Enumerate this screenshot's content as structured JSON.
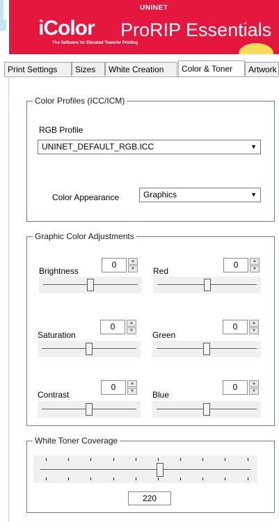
{
  "brand": {
    "top": "UNINET",
    "main": "iColor",
    "product": "ProRIP Essentials",
    "tagline": "The Software for Elevated Transfer Printing",
    "color": "#e5173f"
  },
  "tabs": [
    {
      "label": "Print Settings",
      "active": false
    },
    {
      "label": "Sizes",
      "active": false
    },
    {
      "label": "White Creation",
      "active": false
    },
    {
      "label": "Color & Toner",
      "active": true
    },
    {
      "label": "Artwork",
      "active": false
    }
  ],
  "color_profiles": {
    "title": "Color Profiles (ICC/ICM)",
    "rgb_label": "RGB Profile",
    "rgb_value": "UNINET_DEFAULT_RGB.ICC",
    "appearance_label": "Color Appearance",
    "appearance_value": "Graphics"
  },
  "adjustments": {
    "title": "Graphic Color Adjustments",
    "brightness": {
      "label": "Brightness",
      "value": "0",
      "level": 0
    },
    "red": {
      "label": "Red",
      "value": "0",
      "level": 0
    },
    "saturation": {
      "label": "Saturation",
      "value": "0",
      "level": 0
    },
    "green": {
      "label": "Green",
      "value": "0",
      "level": 0
    },
    "contrast": {
      "label": "Contrast",
      "value": "0",
      "level": 0
    },
    "blue": {
      "label": "Blue",
      "value": "0",
      "level": 0
    }
  },
  "white_toner": {
    "title": "White Toner Coverage",
    "value": "220"
  }
}
